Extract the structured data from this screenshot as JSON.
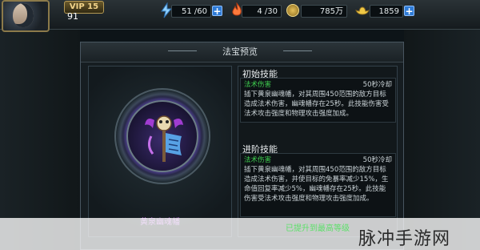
{
  "player": {
    "vip": "VIP 15",
    "level": "91"
  },
  "resources": [
    {
      "name": "stamina",
      "icon": "lightning-icon",
      "value": "51 /60"
    },
    {
      "name": "energy",
      "icon": "flame-icon",
      "value": "4 /30"
    },
    {
      "name": "coins",
      "icon": "coin-icon",
      "value": "785万"
    },
    {
      "name": "ingots",
      "icon": "gold-ingot-icon",
      "value": "1859"
    }
  ],
  "plus_label": "+",
  "dialog": {
    "title": "法宝预览"
  },
  "relic": {
    "name": "黄泉幽魂幡"
  },
  "skills": {
    "initial": {
      "title": "初始技能",
      "type": "法术伤害",
      "cooldown": "50秒冷却",
      "description": "插下黄泉幽魂幡，对其周围450范围的敌方目标造成法术伤害，幽魂幡存在25秒。此技能伤害受法术攻击强度和物理攻击强度加成。"
    },
    "advanced": {
      "title": "进阶技能",
      "type": "法术伤害",
      "cooldown": "50秒冷却",
      "description": "插下黄泉幽魂幡，对其周围450范围的敌方目标造成法术伤害，并使目标的免暴率减少15%，生命值回复率减少5%，幽魂幡存在25秒。此技能伤害受法术攻击强度和物理攻击强度加成。"
    }
  },
  "status": {
    "max_level": "已提升到最高等级"
  },
  "watermark": "脉冲手游网",
  "colors": {
    "accent_green": "#3ecf4f",
    "relic_purple": "#c46fe8",
    "plus_blue": "#2f7bd6"
  }
}
